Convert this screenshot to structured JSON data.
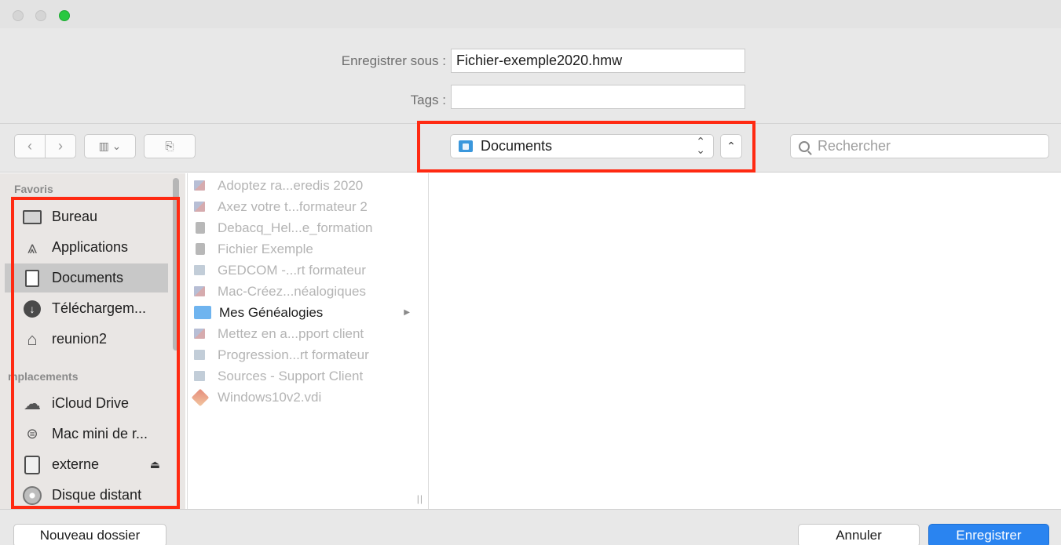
{
  "form": {
    "save_as_label": "Enregistrer sous :",
    "save_as_value": "Fichier-exemple2020.hmw",
    "tags_label": "Tags :",
    "tags_value": ""
  },
  "toolbar": {
    "back_glyph": "‹",
    "forward_glyph": "›",
    "view_glyph": "▥ ⌄",
    "new_folder_glyph": "⎘",
    "location": "Documents",
    "location_chevrons": "⌃⌄",
    "up_glyph": "⌃",
    "search_placeholder": "Rechercher"
  },
  "sidebar": {
    "favorites_label": "Favoris",
    "favorites": [
      {
        "label": "Bureau",
        "icon": "desktop-icon"
      },
      {
        "label": "Applications",
        "icon": "applications-icon"
      },
      {
        "label": "Documents",
        "icon": "documents-icon"
      },
      {
        "label": "Téléchargem...",
        "icon": "downloads-icon"
      },
      {
        "label": "reunion2",
        "icon": "home-icon"
      }
    ],
    "locations_label": "mplacements",
    "locations": [
      {
        "label": "iCloud Drive",
        "icon": "cloud-icon"
      },
      {
        "label": "Mac mini de r...",
        "icon": "computer-icon"
      },
      {
        "label": "externe",
        "icon": "external-disk-icon",
        "eject": "⏏"
      },
      {
        "label": "Disque distant",
        "icon": "remote-disc-icon"
      }
    ]
  },
  "files": [
    {
      "name": "Adoptez ra...eredis 2020",
      "icon": "image-file-icon",
      "enabled": false
    },
    {
      "name": "Axez votre t...formateur 2",
      "icon": "image-file-icon",
      "enabled": false
    },
    {
      "name": "Debacq_Hel...e_formation",
      "icon": "document-file-icon",
      "enabled": false
    },
    {
      "name": "Fichier Exemple",
      "icon": "document-file-icon",
      "enabled": false
    },
    {
      "name": "GEDCOM -...rt formateur",
      "icon": "gedcom-file-icon",
      "enabled": false
    },
    {
      "name": "Mac-Créez...néalogiques",
      "icon": "image-file-icon",
      "enabled": false
    },
    {
      "name": "Mes Généalogies",
      "icon": "folder-icon",
      "enabled": true
    },
    {
      "name": "Mettez en a...pport client",
      "icon": "image-file-icon",
      "enabled": false
    },
    {
      "name": "Progression...rt formateur",
      "icon": "gedcom-file-icon",
      "enabled": false
    },
    {
      "name": "Sources - Support Client",
      "icon": "gedcom-file-icon",
      "enabled": false
    },
    {
      "name": "Windows10v2.vdi",
      "icon": "vdi-file-icon",
      "enabled": false
    }
  ],
  "footer": {
    "new_folder": "Nouveau dossier",
    "cancel": "Annuler",
    "save": "Enregistrer"
  },
  "colors": {
    "highlight_box": "#ff2a12",
    "primary_button": "#2a84f0",
    "folder": "#6fb4ef"
  }
}
